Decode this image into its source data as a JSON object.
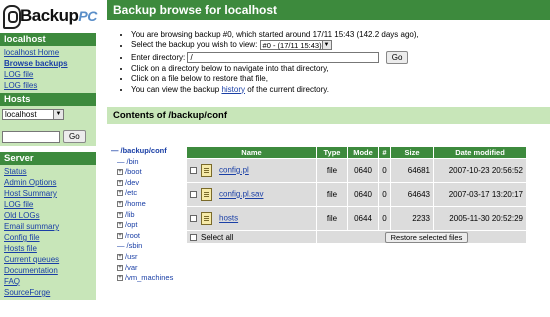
{
  "logo": {
    "text": "Backup",
    "suffix": "PC"
  },
  "sidebar": {
    "host_header": "localhost",
    "host_links": [
      "localhost Home",
      "Browse backups",
      "LOG file",
      "LOG files"
    ],
    "hosts_header": "Hosts",
    "host_select_value": "localhost",
    "go_label": "Go",
    "server_header": "Server",
    "server_links": [
      "Status",
      "Admin Options",
      "Host Summary",
      "LOG file",
      "Old LOGs",
      "Email summary",
      "Config file",
      "Hosts file",
      "Current queues",
      "Documentation",
      "FAQ",
      "SourceForge"
    ]
  },
  "main": {
    "title": "Backup browse for localhost",
    "line1": "You are browsing backup #0, which started around 17/11 15:43 (142.2 days ago),",
    "line2_pre": "Select the backup you wish to view:",
    "backup_select": "#0 - (17/11 15:43)",
    "line3_pre": "Enter directory:",
    "dir_value": "/",
    "go_label": "Go",
    "line4": "Click on a directory below to navigate into that directory,",
    "line5": "Click on a file below to restore that file,",
    "line6_pre": "You can view the backup",
    "line6_link": "history",
    "line6_post": "of the current directory.",
    "contents_header": "Contents of /backup/conf"
  },
  "tree": [
    {
      "label": "/backup/conf",
      "marker": "—",
      "root": true
    },
    {
      "label": "/bin",
      "marker": "—"
    },
    {
      "label": "/boot",
      "marker": "+"
    },
    {
      "label": "/dev",
      "marker": "+"
    },
    {
      "label": "/etc",
      "marker": "+"
    },
    {
      "label": "/home",
      "marker": "+"
    },
    {
      "label": "/lib",
      "marker": "+"
    },
    {
      "label": "/opt",
      "marker": "+"
    },
    {
      "label": "/root",
      "marker": "+"
    },
    {
      "label": "/sbin",
      "marker": "—"
    },
    {
      "label": "/usr",
      "marker": "+"
    },
    {
      "label": "/var",
      "marker": "+"
    },
    {
      "label": "/vm_machines",
      "marker": "+"
    }
  ],
  "table": {
    "headers": [
      "Name",
      "Type",
      "Mode",
      "#",
      "Size",
      "Date modified"
    ],
    "rows": [
      {
        "name": "config.pl",
        "type": "file",
        "mode": "0640",
        "num": "0",
        "size": "64681",
        "date": "2007-10-23 20:56:52"
      },
      {
        "name": "config.pl.sav",
        "type": "file",
        "mode": "0640",
        "num": "0",
        "size": "64643",
        "date": "2007-03-17 13:20:17"
      },
      {
        "name": "hosts",
        "type": "file",
        "mode": "0644",
        "num": "0",
        "size": "2233",
        "date": "2005-11-30 20:52:29"
      }
    ],
    "select_all": "Select all",
    "restore_label": "Restore selected files"
  }
}
